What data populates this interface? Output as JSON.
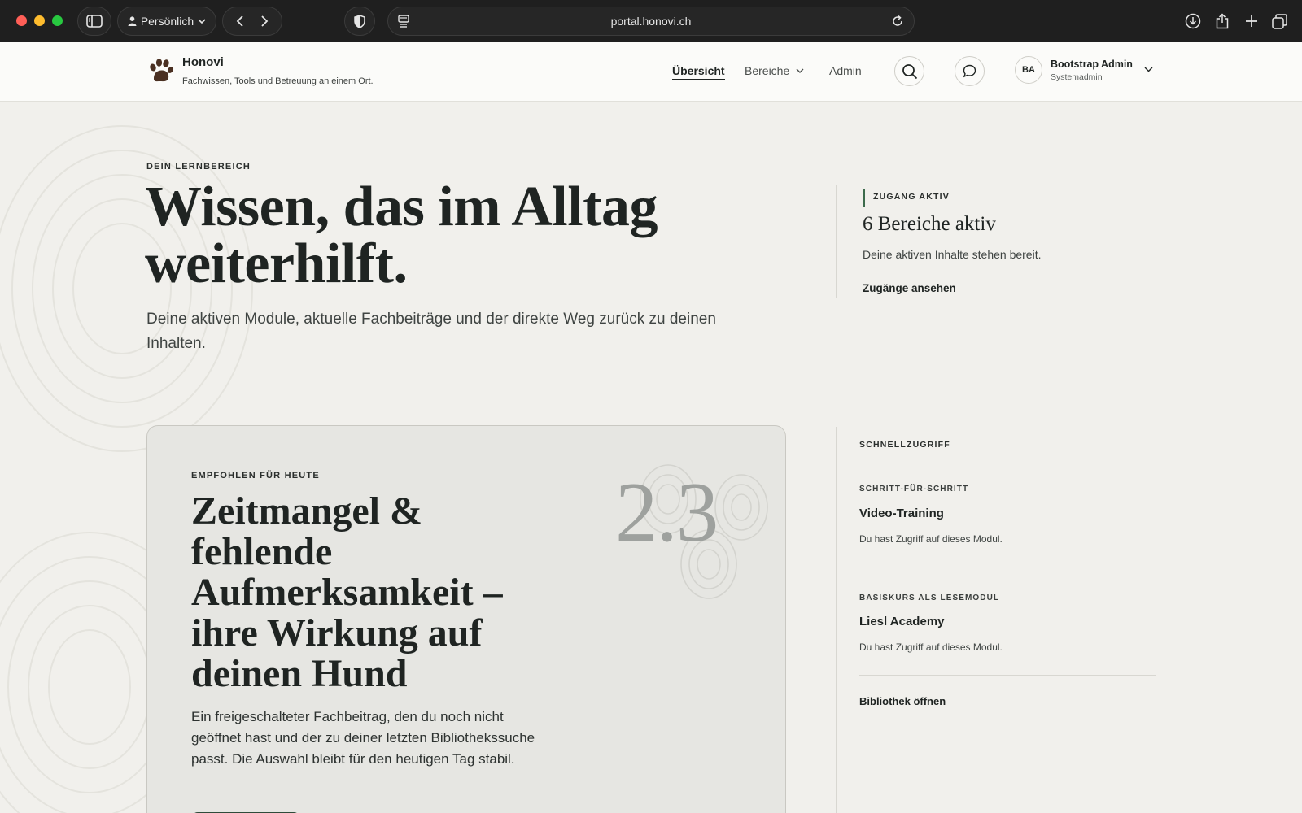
{
  "browser": {
    "profile_label": "Persönlich",
    "url": "portal.honovi.ch"
  },
  "header": {
    "brand_name": "Honovi",
    "tagline": "Fachwissen, Tools und Betreuung an einem Ort.",
    "nav": {
      "overview": "Übersicht",
      "areas": "Bereiche",
      "admin": "Admin"
    },
    "user": {
      "initials": "BA",
      "name": "Bootstrap Admin",
      "role": "Systemadmin"
    }
  },
  "hero": {
    "eyebrow": "DEIN LERNBEREICH",
    "title": "Wissen, das im Alltag weiterhilft.",
    "description": "Deine aktiven Module, aktuelle Fachbeiträge und der direkte Weg zurück zu deinen Inhalten."
  },
  "access": {
    "eyebrow": "ZUGANG AKTIV",
    "title": "6 Bereiche aktiv",
    "description": "Deine aktiven Inhalte stehen bereit.",
    "link": "Zugänge ansehen"
  },
  "featured": {
    "eyebrow": "EMPFOHLEN FÜR HEUTE",
    "title": "Zeitmangel & fehlende Aufmerksamkeit – ihre Wirkung auf deinen Hund",
    "description": "Ein freigeschalteter Fachbeitrag, den du noch nicht geöffnet hast und der zu deiner letzten Bibliothekssuche passt. Die Auswahl bleibt für den heutigen Tag stabil.",
    "number": "2.3"
  },
  "quick_access": {
    "eyebrow": "SCHNELLZUGRIFF",
    "items": [
      {
        "eyebrow": "SCHRITT-FÜR-SCHRITT",
        "title": "Video-Training",
        "description": "Du hast Zugriff auf dieses Modul."
      },
      {
        "eyebrow": "BASISKURS ALS LESEMODUL",
        "title": "Liesl Academy",
        "description": "Du hast Zugriff auf dieses Modul."
      }
    ],
    "library_link": "Bibliothek öffnen"
  },
  "colors": {
    "accent_green": "#3d6b4c",
    "button_green": "#2f4b3a",
    "background": "#f1f0ec",
    "card": "#e6e6e2"
  }
}
